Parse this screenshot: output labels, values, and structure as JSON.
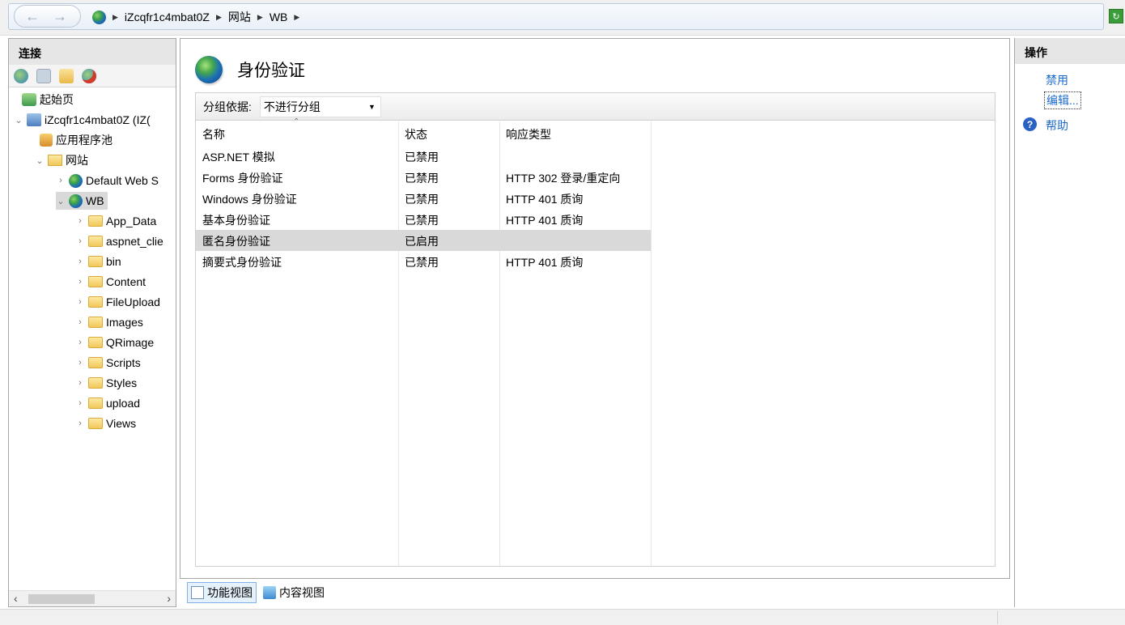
{
  "address": {
    "segments": [
      "iZcqfr1c4mbat0Z",
      "网站",
      "WB"
    ]
  },
  "connections": {
    "header": "连接",
    "tree": {
      "start_page": "起始页",
      "server": "iZcqfr1c4mbat0Z (IZ(",
      "app_pools": "应用程序池",
      "sites": "网站",
      "default_site": "Default Web S",
      "wb": "WB",
      "folders": [
        "App_Data",
        "aspnet_clie",
        "bin",
        "Content",
        "FileUpload",
        "Images",
        "QRimage",
        "Scripts",
        "Styles",
        "upload",
        "Views"
      ]
    }
  },
  "main": {
    "title": "身份验证",
    "group_label": "分组依据:",
    "group_value": "不进行分组",
    "columns": {
      "name": "名称",
      "status": "状态",
      "response": "响应类型"
    },
    "rows": [
      {
        "name": "ASP.NET 模拟",
        "status": "已禁用",
        "response": ""
      },
      {
        "name": "Forms 身份验证",
        "status": "已禁用",
        "response": "HTTP 302 登录/重定向"
      },
      {
        "name": "Windows 身份验证",
        "status": "已禁用",
        "response": "HTTP 401 质询"
      },
      {
        "name": "基本身份验证",
        "status": "已禁用",
        "response": "HTTP 401 质询"
      },
      {
        "name": "匿名身份验证",
        "status": "已启用",
        "response": "",
        "selected": true
      },
      {
        "name": "摘要式身份验证",
        "status": "已禁用",
        "response": "HTTP 401 质询"
      }
    ]
  },
  "views": {
    "features": "功能视图",
    "content": "内容视图"
  },
  "actions": {
    "header": "操作",
    "disable": "禁用",
    "edit": "编辑...",
    "help": "帮助"
  }
}
